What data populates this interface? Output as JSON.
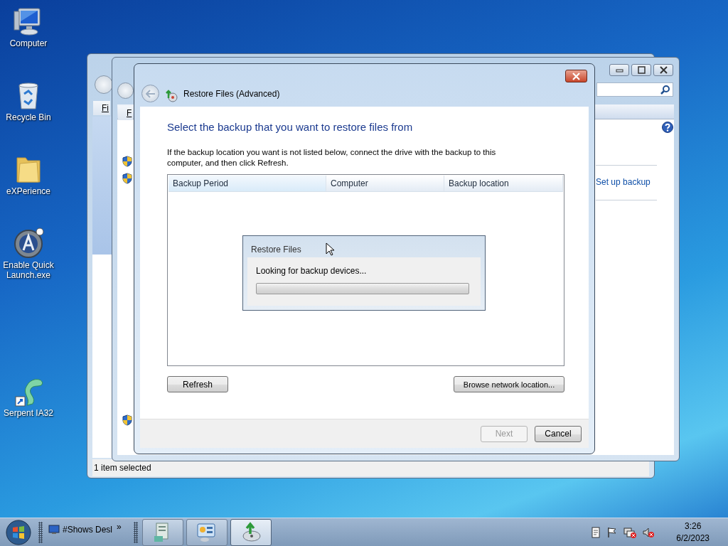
{
  "desktop": {
    "icons": [
      {
        "label": "Computer",
        "kind": "computer"
      },
      {
        "label": "Recycle Bin",
        "kind": "recycle"
      },
      {
        "label": "eXPerience",
        "kind": "folder"
      },
      {
        "label": "Enable Quick Launch.exe",
        "kind": "app"
      },
      {
        "label": "Serpent IA32",
        "kind": "shortcut"
      }
    ]
  },
  "explorer_window": {
    "menu_partial": "Fi",
    "status_bar": "1 item selected"
  },
  "backup_window": {
    "menu_partial": "F",
    "link": "Set up backup"
  },
  "dialog": {
    "title": "Restore Files (Advanced)",
    "heading": "Select the backup that you want to restore files from",
    "instructions": "If the backup location you want is not listed below, connect the drive with the backup to this computer, and then click Refresh.",
    "table": {
      "columns": [
        "Backup Period",
        "Computer",
        "Backup location"
      ]
    },
    "list_buttons": [
      {
        "label": "Refresh",
        "kind": "left"
      },
      {
        "label": "Browse network location...",
        "kind": "right"
      }
    ],
    "footer_buttons": [
      {
        "label": "Next",
        "disabled": true
      },
      {
        "label": "Cancel",
        "disabled": false
      }
    ]
  },
  "progress_dialog": {
    "title": "Restore Files",
    "message": "Looking for backup devices...",
    "level": 0
  },
  "taskbar": {
    "toolbar": {
      "label": "#Shows Desl",
      "chevron": "»"
    },
    "tasks": [
      {
        "kind": "control-panel",
        "selected": false
      },
      {
        "kind": "settings",
        "selected": false
      },
      {
        "kind": "backup",
        "selected": true
      }
    ],
    "clock": {
      "time": "3:26",
      "date": "6/2/2023"
    }
  }
}
